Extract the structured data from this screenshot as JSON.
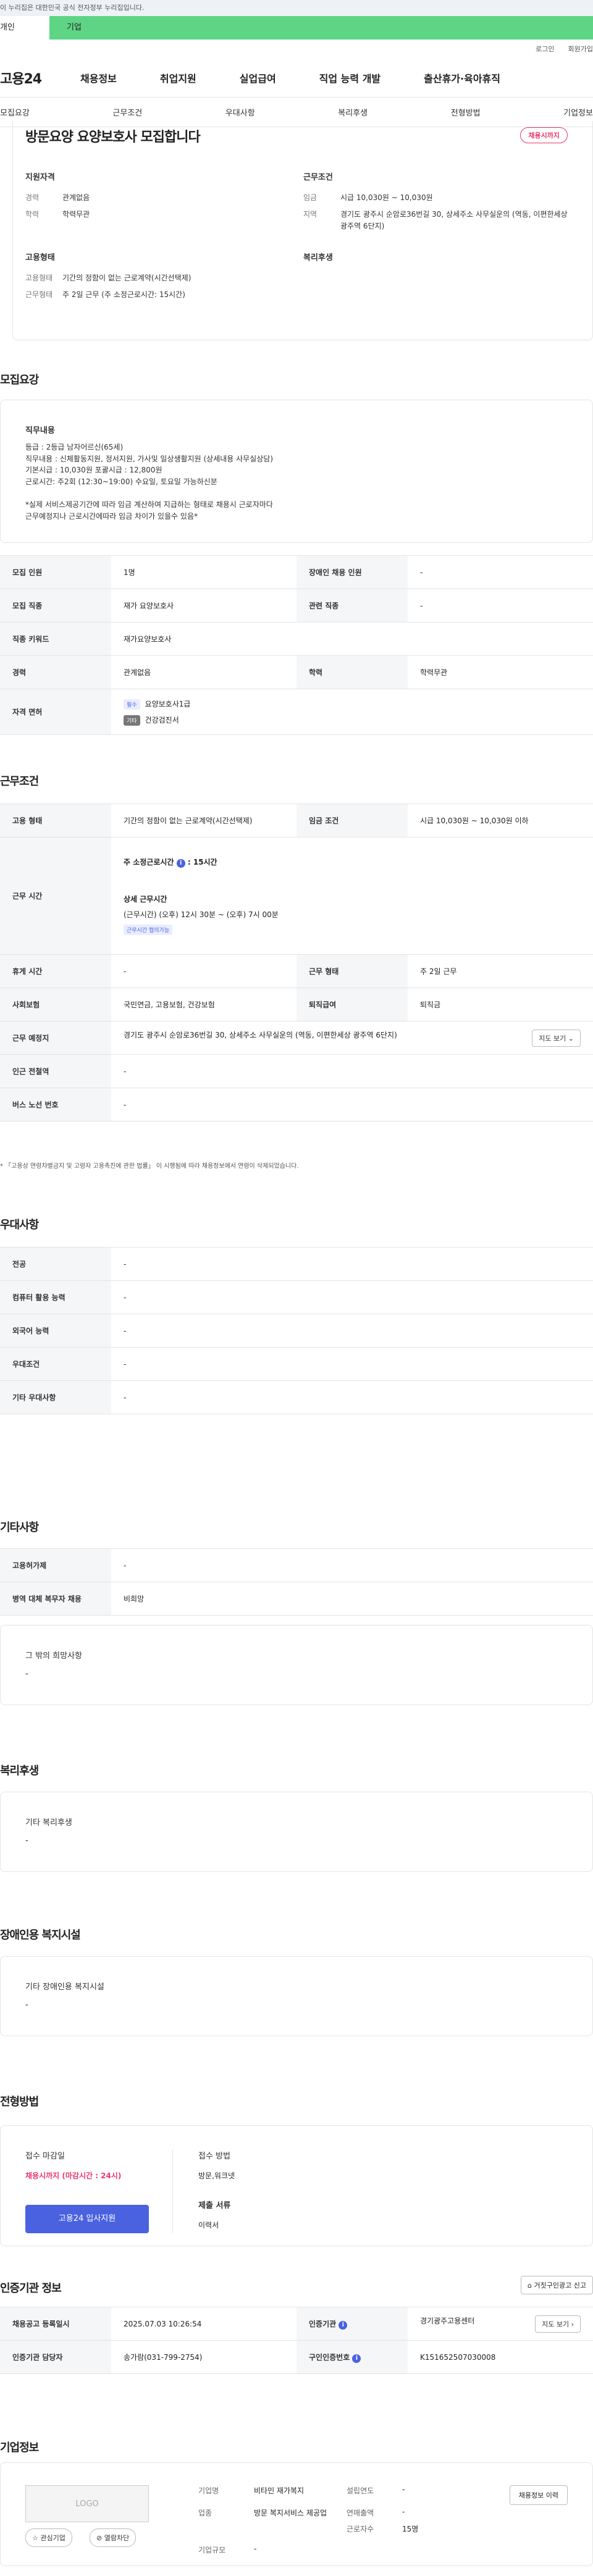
{
  "topbar": {
    "notice": "이 누리집은 대한민국 공식 전자정부 누리집입니다."
  },
  "site_tabs": {
    "personal": "개인",
    "company": "기업"
  },
  "util": {
    "login": "로그인",
    "signup": "회원가입"
  },
  "gnb": {
    "logo": "고용24",
    "menu": [
      "채용정보",
      "취업지원",
      "실업급여",
      "직업 능력 개발",
      "출산휴가·육아휴직"
    ]
  },
  "subtabs": [
    "모집요강",
    "근무조건",
    "우대사항",
    "복리후생",
    "전형방법",
    "기업정보"
  ],
  "hero": {
    "title": "방문요양 요양보호사 모집합니다",
    "deadline_badge": "채용시까지",
    "qual_title": "지원자격",
    "qual": [
      {
        "k": "경력",
        "v": "관계없음"
      },
      {
        "k": "학력",
        "v": "학력무관"
      }
    ],
    "cond_title": "근무조건",
    "cond": [
      {
        "k": "임금",
        "v": "시급 10,030원 ~ 10,030원"
      },
      {
        "k": "지역",
        "v": "경기도 광주시 순암로36번길 30, 상세주소 사무실운의 (역동, 이편한세상 광주역 6단지)"
      }
    ],
    "emp_title": "고용형태",
    "emp": [
      {
        "k": "고용형태",
        "v": "기간의 정함이 없는 근로계약(시간선택제)"
      },
      {
        "k": "근무형태",
        "v": "주 2일 근무 (주 소정근로시간: 15시간)"
      }
    ],
    "welfare_title": "복리후생"
  },
  "recruit": {
    "title": "모집요강",
    "job_title": "직무내용",
    "job_lines": [
      "등급 : 2등급 남자어르신(65세)",
      "직무내용 : 신체활동지원, 정서지원, 가사및 일상생활지원 (상세내용 사무실상담)",
      "기본시급 : 10,030원  포괄시급 : 12,800원",
      "근로시간: 주2회 (12:30~19:00) 수요일, 토요일 가능하신분",
      "",
      "*실제 서비스제공기간에 따라 임금 계산하여 지급하는 형태로 채용시 근로자마다",
      "근무예정지나 근로시간에따라 임금 차이가 있을수 있음*"
    ],
    "rows": {
      "count_k": "모집 인원",
      "count_v": "1명",
      "disabled_k": "장애인 채용 인원",
      "disabled_v": "-",
      "job_k": "모집 직종",
      "job_v": "재가 요양보호사",
      "related_k": "관련 직종",
      "related_v": "-",
      "keyword_k": "직종 키워드",
      "keyword_v": "재가요양보호사",
      "career_k": "경력",
      "career_v": "관계없음",
      "edu_k": "학력",
      "edu_v": "학력무관",
      "license_k": "자격 면허",
      "license_req_tag": "필수",
      "license_req": "요양보호사1급",
      "license_opt_tag": "기타",
      "license_opt": "건강검진서"
    }
  },
  "work": {
    "title": "근무조건",
    "type_k": "고용 형태",
    "type_v": "기간의 정함이 없는 근로계약(시간선택제)",
    "wage_k": "임금 조건",
    "wage_v": "시급 10,030원 ~ 10,030원 이하",
    "time_k": "근무 시간",
    "time_weekly": "주 소정근로시간",
    "time_weekly_v": ": 15시간",
    "time_detail_title": "상세 근무시간",
    "time_detail": "(근무시간) (오후) 12시 30분 ~ (오후) 7시 00분",
    "time_tag": "근무시간 협의가능",
    "rest_k": "휴게 시간",
    "rest_v": "-",
    "shift_k": "근무 형태",
    "shift_v": "주 2일 근무",
    "insurance_k": "사회보험",
    "insurance_v": "국민연금, 고용보험, 건강보험",
    "retire_k": "퇴직급여",
    "retire_v": "퇴직금",
    "place_k": "근무 예정지",
    "place_v": "경기도 광주시 순암로36번길 30, 상세주소 사무실운의 (역동, 이편한세상 광주역 6단지)",
    "map_btn": "지도 보기",
    "subway_k": "인근 전철역",
    "subway_v": "-",
    "bus_k": "버스 노선 번호",
    "bus_v": "-",
    "note": "* 「고용상 연령차별금지 및 고령자 고용촉진에 관한 법률」 이 시행됨에 따라 채용정보에서 연령이 삭제되었습니다."
  },
  "prefer": {
    "title": "우대사항",
    "rows": [
      {
        "k": "전공",
        "v": "-"
      },
      {
        "k": "컴퓨터 활용 능력",
        "v": "-"
      },
      {
        "k": "외국어 능력",
        "v": "-"
      },
      {
        "k": "우대조건",
        "v": "-"
      },
      {
        "k": "기타 우대사항",
        "v": "-"
      }
    ]
  },
  "etc": {
    "title": "기타사항",
    "rows": [
      {
        "k": "고용허가제",
        "v": "-"
      },
      {
        "k": "병역 대체 복무자 채용",
        "v": "비희망"
      }
    ],
    "wish_title": "그 밖의 희망사항",
    "wish_v": "-"
  },
  "welfare": {
    "title": "복리후생",
    "box_title": "기타 복리후생",
    "box_v": "-"
  },
  "disabled": {
    "title": "장애인용 복지시설",
    "box_title": "기타 장애인용 복지시설",
    "box_v": "-"
  },
  "selection": {
    "title": "전형방법",
    "deadline_k": "접수 마감일",
    "deadline_v": "채용시까지 (마감시간 : 24시)",
    "apply_btn": "고용24 입사지원",
    "method_k": "접수 방법",
    "method_v": "방문,워크넷",
    "docs_k": "제출 서류",
    "docs_v": "이력서"
  },
  "cert": {
    "title": "인증기관 정보",
    "report_btn": "거짓구인광고 신고",
    "date_k": "채용공고 등록일시",
    "date_v": "2025.07.03 10:26:54",
    "org_k": "인증기관",
    "org_v": "경기광주고용센터",
    "map_btn": "지도 보기",
    "manager_k": "인증기관 담당자",
    "manager_v": "송가람(031-799-2754)",
    "id_k": "구인인증번호",
    "id_v": "K151652507030008"
  },
  "company": {
    "title": "기업정보",
    "logo": "LOGO",
    "fav_btn": "관심기업",
    "block_btn": "열람차단",
    "name_k": "기업명",
    "name_v": "비타민 재가복지",
    "found_k": "설립연도",
    "found_v": "-",
    "industry_k": "업종",
    "industry_v": "방문 복지서비스 제공업",
    "sales_k": "연매출액",
    "sales_v": "-",
    "staff_k": "근로자수",
    "staff_v": "15명",
    "size_k": "기업규모",
    "size_v": "-",
    "history_btn": "채용정보 이력"
  },
  "colors": {
    "brand_green": "#5ed485",
    "accent_blue": "#4a62e0",
    "deadline_pink": "#e8396b"
  }
}
